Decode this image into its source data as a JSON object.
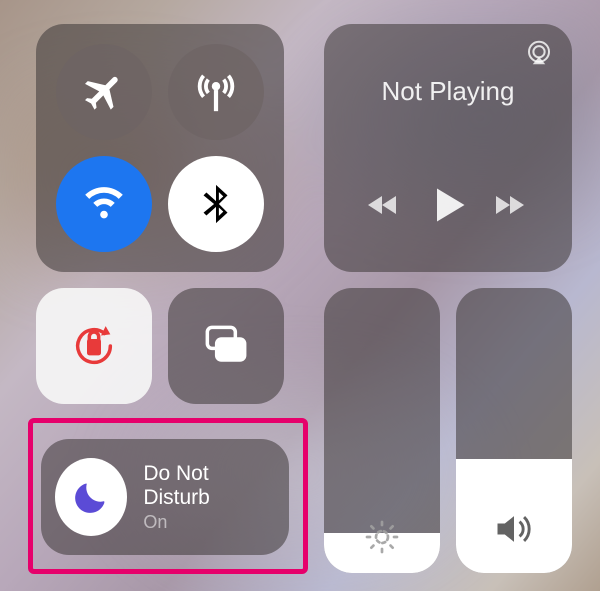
{
  "media": {
    "now_playing_label": "Not Playing"
  },
  "dnd": {
    "title": "Do Not Disturb",
    "state": "On"
  },
  "sliders": {
    "brightness_pct": 14,
    "volume_pct": 40
  },
  "colors": {
    "highlight": "#e6006b",
    "toggle_blue": "#1d76f0"
  },
  "icons": {
    "airplane": "airplane-icon",
    "cellular": "cellular-antenna-icon",
    "wifi": "wifi-icon",
    "bluetooth": "bluetooth-icon",
    "airplay": "airplay-icon",
    "prev": "skip-back-icon",
    "play": "play-icon",
    "next": "skip-forward-icon",
    "orientation_lock": "orientation-lock-icon",
    "screen_mirror": "screen-mirroring-icon",
    "moon": "moon-icon",
    "brightness": "brightness-icon",
    "volume": "volume-icon"
  }
}
